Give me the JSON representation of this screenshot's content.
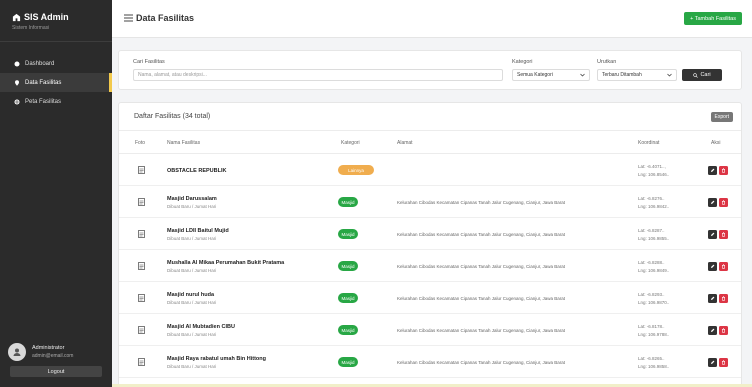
{
  "app": {
    "title": "SIS Admin",
    "subtitle": "Sistem Informasi",
    "colors": {
      "sidebar": "#2b2b2b",
      "accent": "#f2c94c",
      "primary_action": "#28a745",
      "danger": "#dc3545",
      "warning": "#f0ad4e",
      "success": "#28a745"
    }
  },
  "sidebar": {
    "items": [
      {
        "label": "Dashboard",
        "icon": "dashboard-icon",
        "active": false
      },
      {
        "label": "Data Fasilitas",
        "icon": "location-pin-icon",
        "active": true
      },
      {
        "label": "Peta Fasilitas",
        "icon": "map-icon",
        "active": false
      }
    ],
    "user": {
      "name": "Administrator",
      "email": "admin@email.com"
    },
    "logout_label": "Logout"
  },
  "topbar": {
    "page_title": "Data Fasilitas",
    "add_button": "+ Tambah Fasilitas"
  },
  "filter": {
    "search_label": "Cari Fasilitas",
    "search_placeholder": "Nama, alamat, atau deskripsi...",
    "category_label": "Kategori",
    "category_value": "Semua Kategori",
    "sort_label": "Urutkan",
    "sort_value": "Terbaru Ditambah",
    "search_button": "Cari"
  },
  "table": {
    "title": "Daftar Fasilitas (34 total)",
    "export_label": "Export",
    "headers": [
      "Foto",
      "Nama Fasilitas",
      "Kategori",
      "Alamat",
      "Koordinat",
      "Aksi"
    ],
    "rows": [
      {
        "name": "OBSTACLE REPUBLIK",
        "sub": "",
        "category": "Lainnya",
        "badge_color": "#f0ad4e",
        "address": "",
        "lat": "Lat: -6.4071.., ",
        "lng": "Lng: 106.8546.."
      },
      {
        "name": "Masjid Darussalam",
        "sub": "Dibuat Baru / Jumat Hari",
        "category": "Masjid",
        "badge_color": "#28a745",
        "address": "Kelurahan Cibodas Kecamatan Cipanas Tanah Jalur Cugenang, Cianjur, Jawa Barat",
        "lat": "Lat: -6.8276..",
        "lng": "Lng: 106.9842.."
      },
      {
        "name": "Masjid LDII Baitul Mujid",
        "sub": "Dibuat Baru / Jumat Hari",
        "category": "Masjid",
        "badge_color": "#28a745",
        "address": "Kelurahan Cibodas Kecamatan Cipanas Tanah Jalur Cugenang, Cianjur, Jawa Barat",
        "lat": "Lat: -6.8287..",
        "lng": "Lng: 106.9855.."
      },
      {
        "name": "Mushalla Al Mikaa Perumahan Bukit Pratama",
        "sub": "Dibuat Baru / Jumat Hari",
        "category": "Masjid",
        "badge_color": "#28a745",
        "address": "Kelurahan Cibodas Kecamatan Cipanas Tanah Jalur Cugenang, Cianjur, Jawa Barat",
        "lat": "Lat: -6.8288..",
        "lng": "Lng: 106.9849.."
      },
      {
        "name": "Masjid nurul huda",
        "sub": "Dibuat Baru / Jumat Hari",
        "category": "Masjid",
        "badge_color": "#28a745",
        "address": "Kelurahan Cibodas Kecamatan Cipanas Tanah Jalur Cugenang, Cianjur, Jawa Barat",
        "lat": "Lat: -6.8293..",
        "lng": "Lng: 106.9870.."
      },
      {
        "name": "Masjid Al Mubtadien CIBU",
        "sub": "Dibuat Baru / Jumat Hari",
        "category": "Masjid",
        "badge_color": "#28a745",
        "address": "Kelurahan Cibodas Kecamatan Cipanas Tanah Jalur Cugenang, Cianjur, Jawa Barat",
        "lat": "Lat: -6.8178..",
        "lng": "Lng: 106.9788.."
      },
      {
        "name": "Masjid Raya rabatul umah Bin Hittong",
        "sub": "Dibuat Baru / Jumat Hari",
        "category": "Masjid",
        "badge_color": "#28a745",
        "address": "Kelurahan Cibodas Kecamatan Cipanas Tanah Jalur Cugenang, Cianjur, Jawa Barat",
        "lat": "Lat: -6.8265..",
        "lng": "Lng: 106.9858.."
      }
    ]
  }
}
